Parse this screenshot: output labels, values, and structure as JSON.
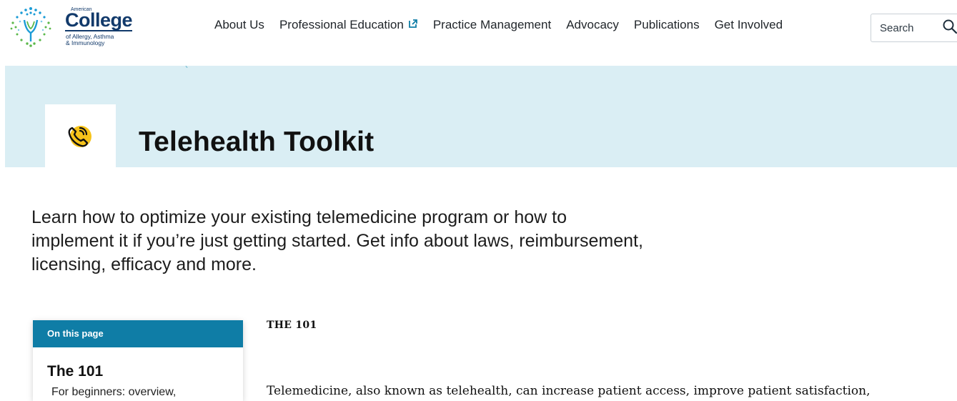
{
  "logo": {
    "top_line": "American",
    "name": "College",
    "sub_line1": "of Allergy, Asthma",
    "sub_line2": "& Immunology"
  },
  "nav": {
    "items": [
      {
        "label": "About Us"
      },
      {
        "label": "Professional Education",
        "external": true
      },
      {
        "label": "Practice Management"
      },
      {
        "label": "Advocacy"
      },
      {
        "label": "Publications"
      },
      {
        "label": "Get Involved"
      }
    ]
  },
  "search": {
    "placeholder": "Search",
    "icon": "search-icon"
  },
  "hero": {
    "title": "Telehealth Toolkit",
    "icon": "phone-call-icon",
    "background": "#daeef4",
    "icon_color": "#f6c31a"
  },
  "intro": {
    "text": "Learn how to optimize your existing telemedicine program or how to implement it if you’re just getting started. Get info about laws, reimbursement, licensing, efficacy and more."
  },
  "on_this_page": {
    "header": "On this page",
    "section_title": "The 101",
    "section_desc": "For beginners: overview,",
    "accent": "#0f7da6"
  },
  "content": {
    "section_label": "THE 101",
    "paragraph": "Telemedicine, also known as telehealth, can increase patient access, improve patient satisfaction,"
  }
}
